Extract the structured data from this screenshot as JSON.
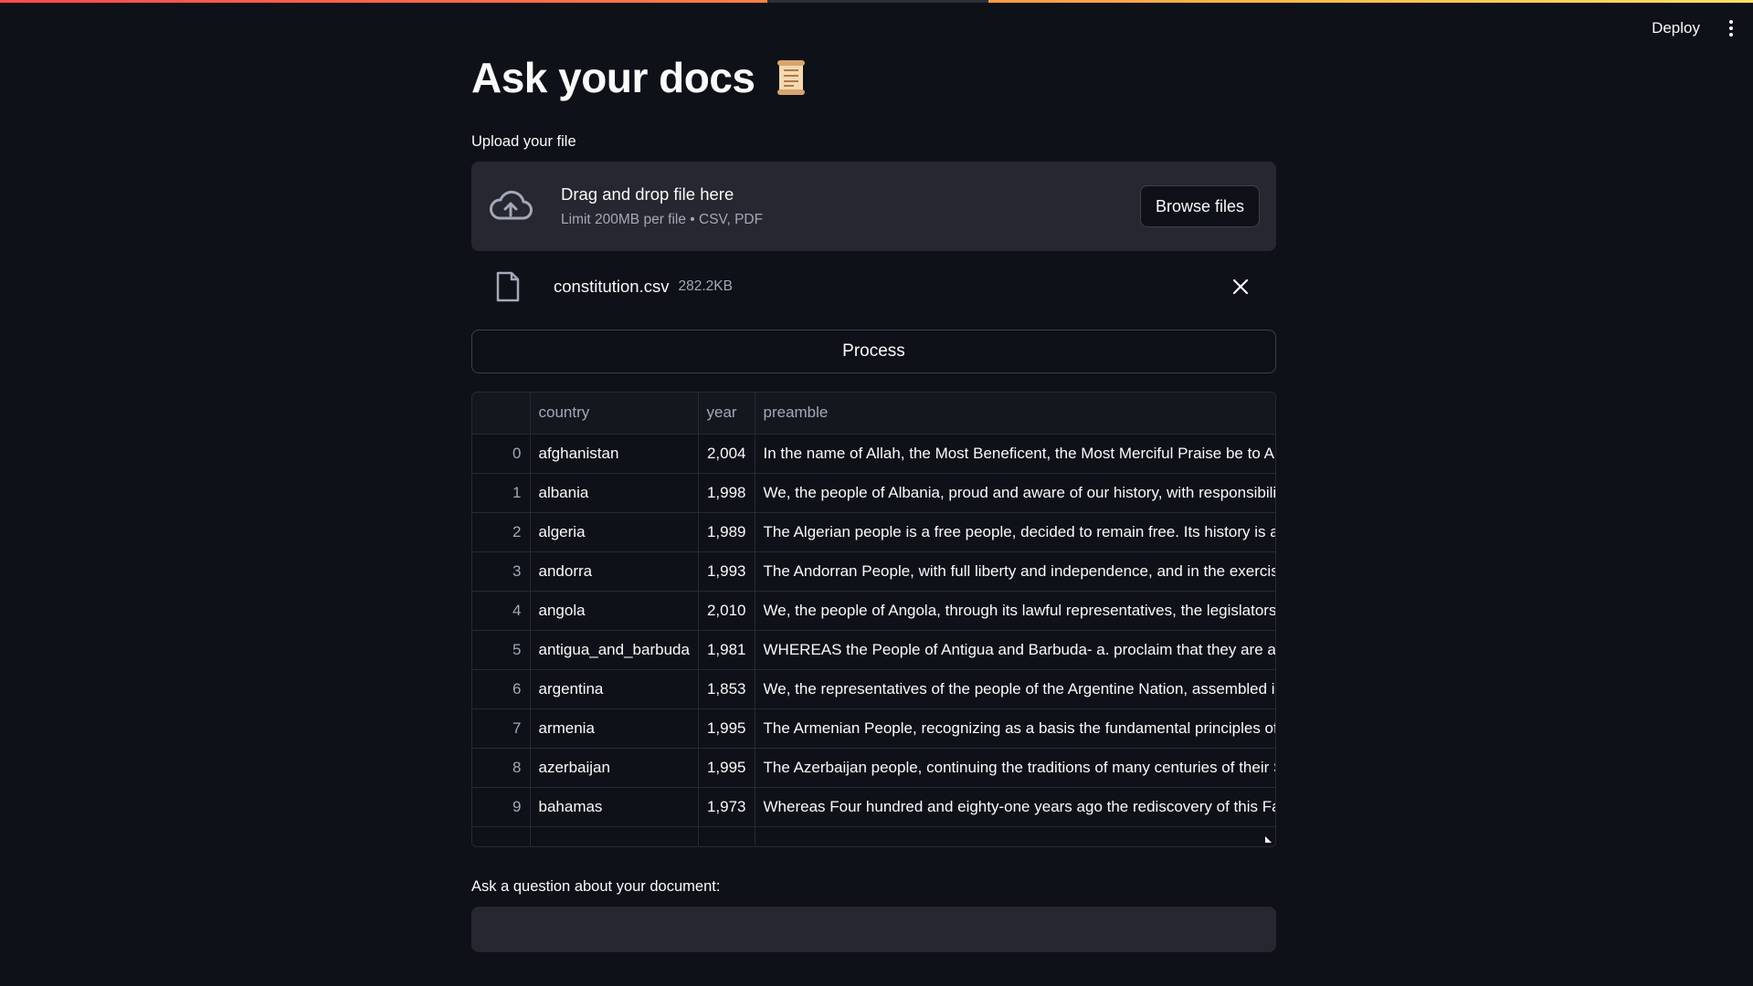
{
  "header": {
    "deploy_label": "Deploy",
    "menu_icon": "kebab-menu-icon"
  },
  "page": {
    "title": "Ask your docs",
    "title_icon": "scroll-icon"
  },
  "uploader": {
    "label": "Upload your file",
    "dropzone_title": "Drag and drop file here",
    "dropzone_subtitle": "Limit 200MB per file • CSV, PDF",
    "browse_label": "Browse files",
    "icon": "cloud-upload-icon"
  },
  "uploaded_file": {
    "name": "constitution.csv",
    "size": "282.2KB",
    "icon": "file-icon"
  },
  "process_button": {
    "label": "Process"
  },
  "table": {
    "columns": [
      "",
      "country",
      "year",
      "preamble"
    ],
    "rows": [
      [
        "0",
        "afghanistan",
        "2,004",
        "In the name of Allah, the Most Beneficent, the Most Merciful Praise be to Allah"
      ],
      [
        "1",
        "albania",
        "1,998",
        "We, the people of Albania, proud and aware of our history, with responsibility"
      ],
      [
        "2",
        "algeria",
        "1,989",
        "The Algerian people is a free people, decided to remain free. Its history is a lor"
      ],
      [
        "3",
        "andorra",
        "1,993",
        "The Andorran People, with full liberty and independence, and in the exercise"
      ],
      [
        "4",
        "angola",
        "2,010",
        "We, the people of Angola, through its lawful representatives, the legislators of"
      ],
      [
        "5",
        "antigua_and_barbuda",
        "1,981",
        "WHEREAS the People of Antigua and Barbuda- a. proclaim that they are a sov"
      ],
      [
        "6",
        "argentina",
        "1,853",
        "We, the representatives of the people of the Argentine Nation, assembled in G"
      ],
      [
        "7",
        "armenia",
        "1,995",
        "The Armenian People, recognizing as a basis the fundamental principles of th"
      ],
      [
        "8",
        "azerbaijan",
        "1,995",
        "The Azerbaijan people, continuing the traditions of many centuries of their St"
      ],
      [
        "9",
        "bahamas",
        "1,973",
        "Whereas Four hundred and eighty-one years ago the rediscovery of this Famil"
      ]
    ]
  },
  "question": {
    "label": "Ask a question about your document:",
    "value": "",
    "placeholder": ""
  },
  "colors": {
    "background": "#0e1117",
    "secondary_background": "#262730",
    "text": "#fafafa",
    "muted_text": "#a3a8b8",
    "accent_red": "#ff4b4b"
  }
}
